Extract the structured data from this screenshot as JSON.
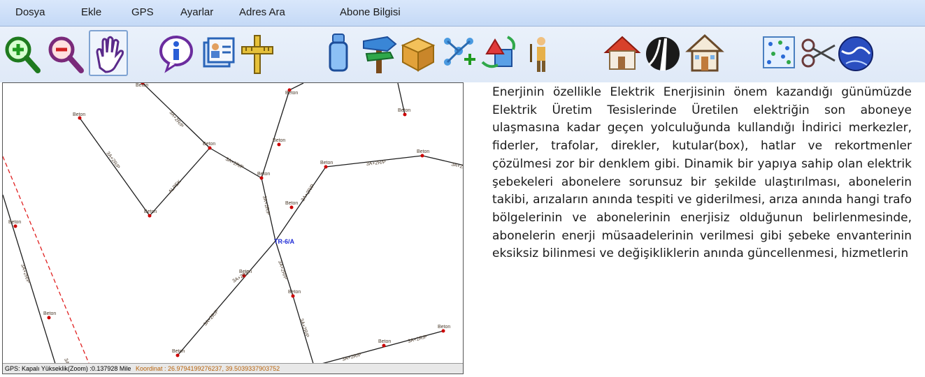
{
  "menu": {
    "items": [
      "Dosya",
      "Ekle",
      "GPS",
      "Ayarlar",
      "Adres Ara",
      "Abone Bilgisi"
    ]
  },
  "toolbar": {
    "icons": [
      "zoom-in-icon",
      "zoom-out-icon",
      "pan-hand-icon",
      "info-icon",
      "properties-card-icon",
      "measure-cross-icon",
      "pole-icon",
      "signpost-icon",
      "box-icon",
      "network-add-icon",
      "transform-icon",
      "person-icon",
      "house-icon",
      "road-icon",
      "building-icon",
      "points-grid-icon",
      "scissors-icon",
      "globe-icon"
    ],
    "selected": "pan-hand-icon"
  },
  "map": {
    "pole_label": "Beton",
    "line_labels": [
      "3A+2R/P",
      "ALPEK",
      "3A+2R/P",
      "3A+2R/P"
    ],
    "transformer_label": "TR-6/A",
    "colors": {
      "line": "#1e1e1e",
      "pole": "#cc0000",
      "transformer": "#1f2bd6",
      "dashed": "#e02020",
      "label": "#4a3a2a"
    }
  },
  "status": {
    "gps": "GPS: Kapalı  Yükseklik(Zoom) :0.137928 Mile",
    "coord": "Koordinat : 26.9794199276237, 39.5039337903752"
  },
  "description": {
    "text": "Enerjinin özellikle Elektrik Enerjisinin önem kazandığı günümüzde Elektrik Üretim Tesislerinde Üretilen elektriğin son aboneye ulaşmasına kadar geçen yolculuğunda kullandığı İndirici merkezler, fiderler, trafolar, direkler, kutular(box), hatlar ve rekortmenler çözülmesi  zor bir denklem gibi. Dinamik bir yapıya sahip olan elektrik şebekeleri abonelere sorunsuz bir şekilde ulaştırılması, abonelerin takibi, arızaların anında tespiti ve giderilmesi, arıza anında hangi trafo bölgelerinin ve abonelerinin enerjisiz olduğunun belirlenmesinde, abonelerin enerji müsaadelerinin verilmesi gibi şebeke envanterinin eksiksiz bilinmesi ve değişikliklerin anında güncellenmesi, hizmetlerin"
  }
}
